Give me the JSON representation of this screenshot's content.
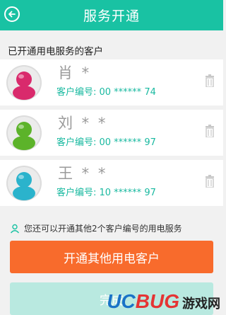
{
  "header": {
    "title": "服务开通",
    "back_icon": "back-arrow-circle-icon"
  },
  "section": {
    "label": "已开通用电服务的客户"
  },
  "customers": [
    {
      "name": "肖 *",
      "number": "客户编号: 00 ****** 74",
      "avatar_color": "#d92a6c"
    },
    {
      "name": "刘 * *",
      "number": "客户编号: 00 ****** 97",
      "avatar_color": "#5cb32a"
    },
    {
      "name": "王 * *",
      "number": "客户编号: 10 ****** 97",
      "avatar_color": "#2bb3cc"
    }
  ],
  "delete_icon": "trash-icon",
  "hint": {
    "text": "您还可以开通其他2个客户编号的用电服务",
    "icon": "user-icon"
  },
  "buttons": {
    "open_other": "开通其他用电客户",
    "done": "完成"
  },
  "watermark": {
    "part1": "UC",
    "part2": "BUG",
    "part3": "游戏网"
  },
  "colors": {
    "accent": "#19c2a3",
    "orange": "#f86b2c",
    "done_disabled": "#b9e9e0"
  }
}
